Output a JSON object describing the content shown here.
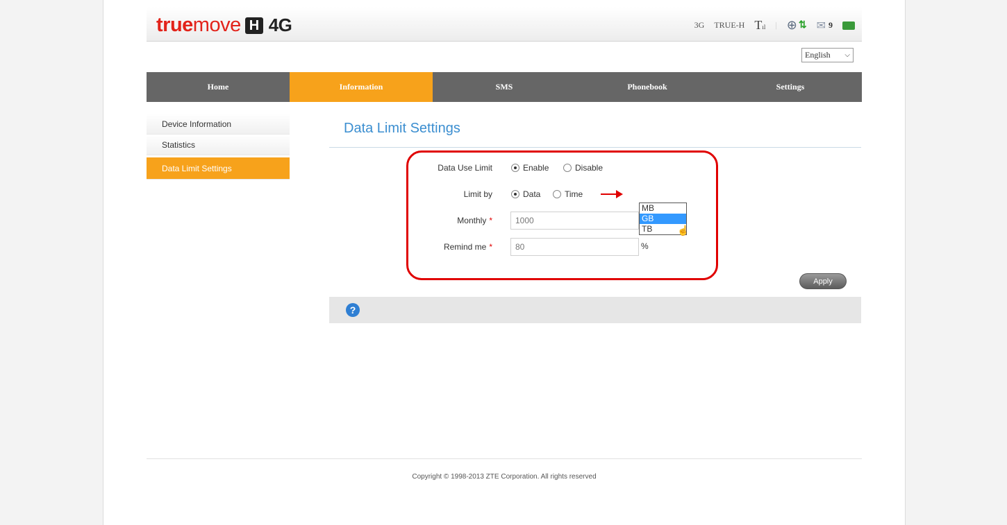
{
  "header": {
    "logo_true": "true",
    "logo_move": "move",
    "logo_h": "H",
    "logo_4g": "4G",
    "network_type": "3G",
    "operator": "TRUE-H",
    "signal_icon": "signal-strength-icon",
    "message_count": "9"
  },
  "language": {
    "selected": "English"
  },
  "nav": {
    "items": [
      {
        "label": "Home"
      },
      {
        "label": "Information"
      },
      {
        "label": "SMS"
      },
      {
        "label": "Phonebook"
      },
      {
        "label": "Settings"
      }
    ],
    "active_color": "#f7a21b"
  },
  "sidebar": {
    "items": [
      {
        "label": "Device Information"
      },
      {
        "label": "Statistics"
      },
      {
        "label": "Data Limit Settings"
      }
    ]
  },
  "main": {
    "title": "Data Limit Settings",
    "data_use_limit": {
      "label": "Data Use Limit",
      "enable": "Enable",
      "disable": "Disable",
      "selected": "Enable"
    },
    "limit_by": {
      "label": "Limit by",
      "data": "Data",
      "time": "Time",
      "selected": "Data"
    },
    "monthly": {
      "label": "Monthly",
      "required": "*",
      "value": "1000"
    },
    "remind_me": {
      "label": "Remind me",
      "required": "*",
      "value": "80",
      "unit": "%"
    },
    "unit_options": [
      "MB",
      "GB",
      "TB"
    ],
    "unit_selected": "GB",
    "apply_label": "Apply"
  },
  "footer": {
    "copyright": "Copyright © 1998-2013 ZTE Corporation. All rights reserved"
  }
}
